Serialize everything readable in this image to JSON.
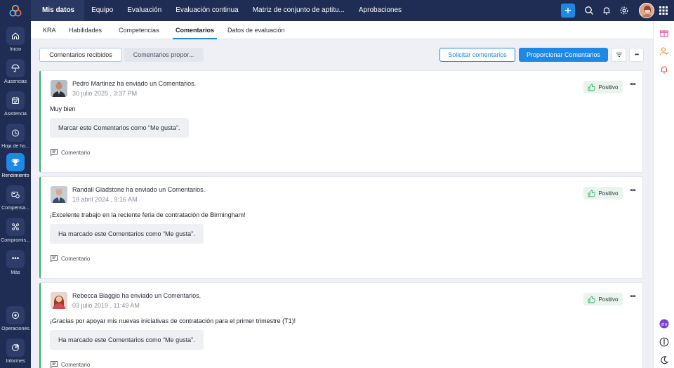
{
  "colors": {
    "rail": "#1f2c53",
    "accent": "#1e88e5",
    "positive": "#34b36a",
    "background": "#eef0f5"
  },
  "left_rail": {
    "items": [
      {
        "label": "Inicio",
        "icon": "home-icon"
      },
      {
        "label": "Ausencias",
        "icon": "umbrella-icon"
      },
      {
        "label": "Asistencia",
        "icon": "calendar-icon"
      },
      {
        "label": "Hoja de ho...",
        "icon": "timesheet-icon"
      },
      {
        "label": "Rendimiento",
        "icon": "trophy-icon",
        "active": true
      },
      {
        "label": "Compensa...",
        "icon": "compensation-icon"
      },
      {
        "label": "Compromis...",
        "icon": "engagement-icon"
      },
      {
        "label": "Más",
        "icon": "more-icon"
      },
      {
        "label": "Operaciones",
        "icon": "operations-icon"
      },
      {
        "label": "Informes",
        "icon": "reports-icon"
      }
    ]
  },
  "top_nav": {
    "items": [
      "Mis datos",
      "Equipo",
      "Evaluación",
      "Evaluación continua",
      "Matriz de conjunto de aptitu...",
      "Aprobaciones"
    ],
    "active": "Mis datos"
  },
  "sub_tabs": {
    "items": [
      "KRA",
      "Habilidades",
      "Competencias",
      "Comentarios",
      "Datos de evaluación"
    ],
    "active": "Comentarios"
  },
  "toolbar": {
    "received_label": "Comentarios recibidos",
    "given_label": "Comentarios propor...",
    "request_label": "Solicitar comentarios",
    "give_label": "Proporcionar Comentarios"
  },
  "feedback": [
    {
      "author_line": "Pedro Martinez ha enviado un Comentarios.",
      "date": "30 julio 2025 , 3:37 PM",
      "badge": "Positivo",
      "message": "Muy bien",
      "like_label": "Marcar este Comentarios como “Me gusta”.",
      "comment_label": "Comentario"
    },
    {
      "author_line": "Randall Gladstone ha enviado un Comentarios.",
      "date": "19 abril 2024 , 9:16 AM",
      "badge": "Positivo",
      "message": "¡Excelente trabajo en la reciente feria de contratación de Birmingham!",
      "like_label": "Ha marcado este Comentarios como “Me gusta”.",
      "comment_label": "Comentario"
    },
    {
      "author_line": "Rebecca Biaggio ha enviado un Comentarios.",
      "date": "03 julio 2019 , 11:49 AM",
      "badge": "Positivo",
      "message": "¡Gracias por apoyar mis nuevas iniciativas de contratación para el primer trimestre (T1)!",
      "like_label": "Ha marcado este Comentarios como “Me gusta”.",
      "comment_label": "Comentario"
    }
  ]
}
